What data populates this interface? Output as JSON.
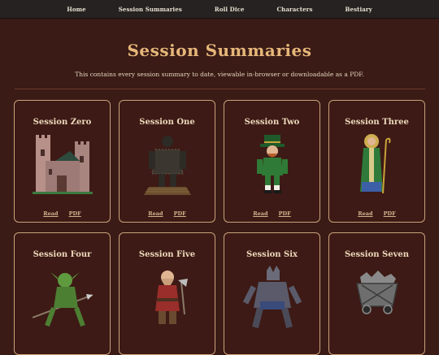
{
  "nav": {
    "items": [
      "Home",
      "Session Summaries",
      "Roll Dice",
      "Characters",
      "Bestiary"
    ]
  },
  "page": {
    "title": "Session Summaries",
    "subtitle": "This contains every session summary to date, viewable in-browser or downloadable as a PDF."
  },
  "sessions": [
    {
      "title": "Session Zero",
      "read": "Read",
      "pdf": "PDF",
      "art": "castle-icon"
    },
    {
      "title": "Session One",
      "read": "Read",
      "pdf": "PDF",
      "art": "wicker-man-icon"
    },
    {
      "title": "Session Two",
      "read": "Read",
      "pdf": "PDF",
      "art": "leprechaun-icon"
    },
    {
      "title": "Session Three",
      "read": "Read",
      "pdf": "PDF",
      "art": "saint-icon"
    },
    {
      "title": "Session Four",
      "read": "",
      "pdf": "",
      "art": "goblin-spear-icon"
    },
    {
      "title": "Session Five",
      "read": "",
      "pdf": "",
      "art": "dwarf-icon"
    },
    {
      "title": "Session Six",
      "read": "",
      "pdf": "",
      "art": "werewolf-icon"
    },
    {
      "title": "Session Seven",
      "read": "",
      "pdf": "",
      "art": "mine-cart-icon"
    }
  ],
  "colors": {
    "background": "#3a1b16",
    "nav": "#252221",
    "title": "#e6b77a",
    "card_border": "#c9a27a",
    "link": "#d4b38e"
  }
}
